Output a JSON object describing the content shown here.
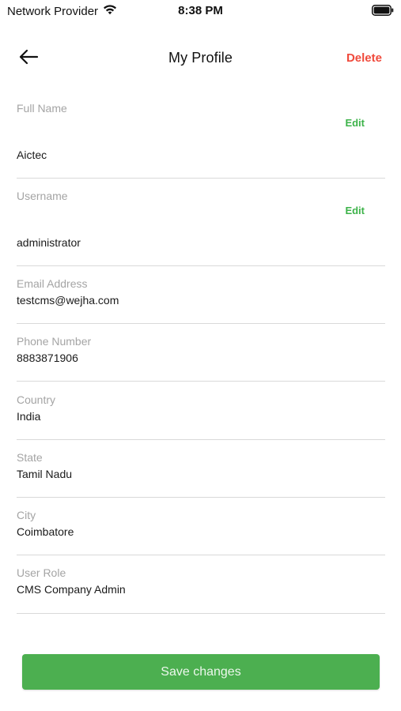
{
  "status_bar": {
    "carrier": "Network Provider",
    "time": "8:38 PM",
    "wifi_icon": "wifi-icon",
    "battery_icon": "battery-icon"
  },
  "header": {
    "title": "My Profile",
    "back_icon": "arrow-left-icon",
    "delete_label": "Delete"
  },
  "fields": {
    "full_name": {
      "label": "Full Name",
      "value": "Aictec",
      "edit_label": "Edit"
    },
    "username": {
      "label": "Username",
      "value": "administrator",
      "edit_label": "Edit"
    },
    "email": {
      "label": "Email Address",
      "value": "testcms@wejha.com"
    },
    "phone": {
      "label": "Phone Number",
      "value": "8883871906"
    },
    "country": {
      "label": "Country",
      "value": "India"
    },
    "state": {
      "label": "State",
      "value": "Tamil Nadu"
    },
    "city": {
      "label": "City",
      "value": "Coimbatore"
    },
    "user_role": {
      "label": "User Role",
      "value": "CMS Company Admin"
    }
  },
  "actions": {
    "save_label": "Save changes"
  },
  "colors": {
    "accent_green": "#4caf50",
    "edit_green": "#3db34a",
    "delete_red": "#f04a3c",
    "label_gray": "#a4a4a4",
    "divider": "#d9d9d9"
  }
}
